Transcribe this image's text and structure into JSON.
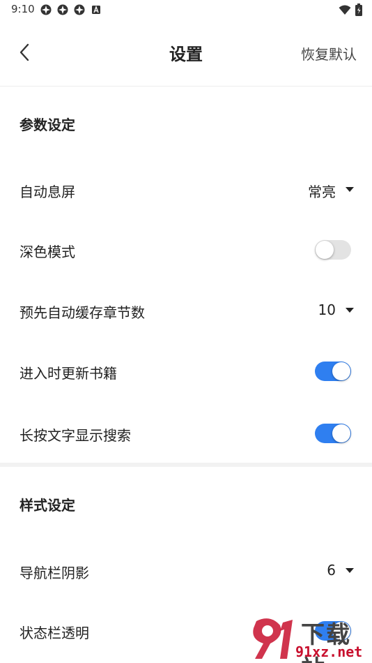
{
  "status_bar": {
    "time": "9:10",
    "left_icons": [
      "app-notification-icon",
      "app-notification-icon",
      "app-notification-icon",
      "a-box-icon"
    ],
    "right_icons": [
      "wifi-icon",
      "battery-icon"
    ]
  },
  "nav": {
    "title": "设置",
    "restore_label": "恢复默认"
  },
  "sections": {
    "params": {
      "title": "参数设定",
      "auto_screen_off": {
        "label": "自动息屏",
        "value": "常亮"
      },
      "dark_mode": {
        "label": "深色模式",
        "on": false
      },
      "precache": {
        "label": "预先自动缓存章节数",
        "value": "10"
      },
      "update_books": {
        "label": "进入时更新书籍",
        "on": true
      },
      "long_press_search": {
        "label": "长按文字显示搜索",
        "on": true
      }
    },
    "style": {
      "title": "样式设定",
      "nav_shadow": {
        "label": "导航栏阴影",
        "value": "6"
      },
      "status_transparent": {
        "label": "状态栏透明",
        "on": true
      }
    }
  },
  "watermark": {
    "top": "下载站",
    "bottom": "91xz.net"
  },
  "colors": {
    "accent": "#2f7ff0",
    "toggle_off": "#e3e3e3",
    "watermark_red": "#c8102e"
  }
}
